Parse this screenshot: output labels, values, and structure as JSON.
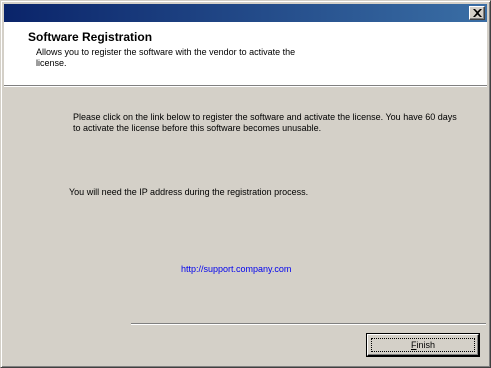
{
  "window": {
    "title_bar_color": "#0a246a"
  },
  "header": {
    "title": "Software Registration",
    "subtitle": "Allows you to register the software with the vendor to activate the license."
  },
  "body": {
    "instruction": "Please click on the link below to register the software and activate the license. You have 60 days to activate the license before this software becomes unusable.",
    "ip_note": "You will need the IP address during the registration process.",
    "link_text": "http://support.company.com"
  },
  "footer": {
    "finish_label": "Finish"
  },
  "icons": {
    "close": "close-icon"
  }
}
